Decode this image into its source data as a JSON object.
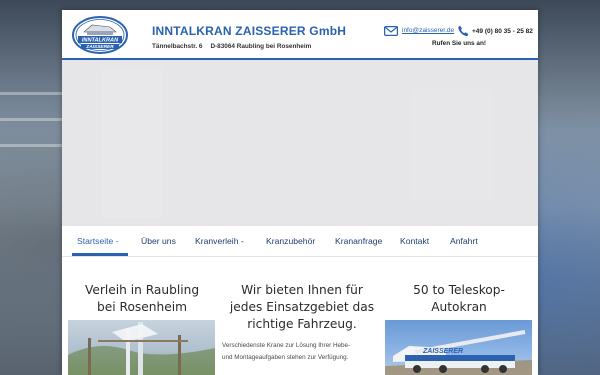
{
  "header": {
    "logo_text_top": "INNTALKRAN",
    "logo_text_bottom": "ZAISSERER",
    "company": "INNTALKRAN ZAISSERER GmbH",
    "street": "Tännelbachstr. 6",
    "city": "D-83064 Raubling bei Rosenheim",
    "email": "info@zaisserer.de",
    "phone": "+49 (0) 80 35 - 25 82",
    "call_note": "Rufen Sie uns an!"
  },
  "nav": {
    "items": [
      {
        "label": "Startseite -",
        "active": true
      },
      {
        "label": "Über uns",
        "active": false
      },
      {
        "label": "Kranverleih -",
        "active": false
      },
      {
        "label": "Kranzubehör",
        "active": false
      },
      {
        "label": "Krananfrage",
        "active": false
      },
      {
        "label": "Kontakt",
        "active": false
      },
      {
        "label": "Anfahrt",
        "active": false
      }
    ]
  },
  "columns": {
    "left": {
      "title_line1": "Verleih in Raubling",
      "title_line2": "bei Rosenheim"
    },
    "middle": {
      "title_line1": "Wir bieten Ihnen für",
      "title_line2": "jedes Einsatzgebiet das",
      "title_line3": "richtige Fahrzeug.",
      "text_line1": "Verschiedenste Krane zur Lösung Ihrer Hebe-",
      "text_line2": "und Montageaufgaben stehen zur Verfügung."
    },
    "right": {
      "title_line1": "50 to Teleskop-",
      "title_line2": "Autokran",
      "image_text": "ZAISSERER"
    }
  },
  "colors": {
    "brand_blue": "#2a62b0",
    "nav_text": "#1f3f6e"
  }
}
